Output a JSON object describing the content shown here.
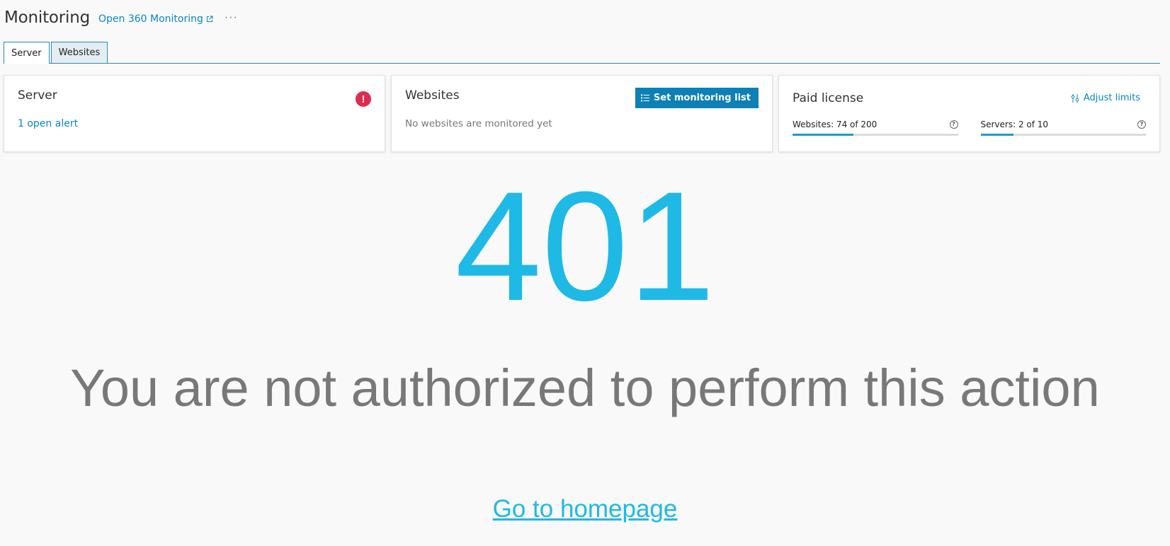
{
  "header": {
    "title": "Monitoring",
    "link_label": "Open 360 Monitoring",
    "more_label": "···"
  },
  "tabs": [
    {
      "label": "Server",
      "active": true
    },
    {
      "label": "Websites",
      "active": false
    }
  ],
  "cards": {
    "server": {
      "title": "Server",
      "alert_link": "1 open alert",
      "alert_icon": "!"
    },
    "websites": {
      "title": "Websites",
      "button_label": "Set monitoring list",
      "empty_text": "No websites are monitored yet"
    },
    "license": {
      "title": "Paid license",
      "adjust_label": "Adjust limits",
      "meters": [
        {
          "label": "Websites: 74 of 200",
          "fraction": 0.37
        },
        {
          "label": "Servers: 2 of 10",
          "fraction": 0.2
        }
      ]
    }
  },
  "error": {
    "code": "401",
    "message": "You are not authorized to perform this action",
    "home_link": "Go to homepage"
  },
  "colors": {
    "accent": "#0a86c6",
    "error_code": "#1fb9e6",
    "alert": "#dd2b4e",
    "button": "#0d80b5"
  }
}
